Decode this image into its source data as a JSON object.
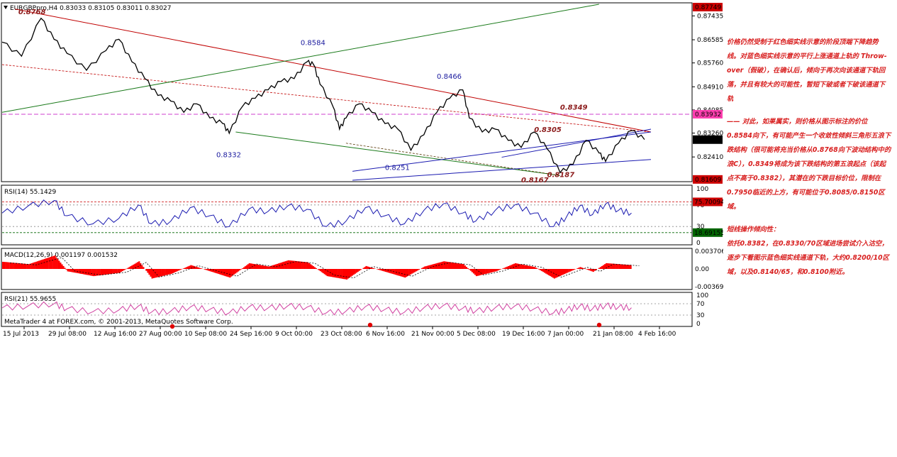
{
  "chart_data": [
    {
      "type": "line",
      "panel": "price",
      "series_name": "EURGBPpro,H4",
      "ohlc_text": "0.83033 0.83105 0.83011 0.83027",
      "yticks": [
        "0.87435",
        "0.86585",
        "0.85760",
        "0.84910",
        "0.84085",
        "0.83260",
        "0.82410"
      ],
      "ylim": [
        0.8158,
        0.8785
      ],
      "price_tags": [
        {
          "text": "0.87749",
          "value": 0.87749,
          "bg": "#cc0000",
          "fg": "#ffffff"
        },
        {
          "text": "0.83932",
          "value": 0.83932,
          "bg": "#ff3fb0",
          "fg": "#ffffff"
        },
        {
          "text": "0.83027",
          "value": 0.83027,
          "bg": "#000000",
          "fg": "#ffffff"
        },
        {
          "text": "0.81609",
          "value": 0.81609,
          "bg": "#cc0000",
          "fg": "#ffffff"
        }
      ],
      "annotations": [
        {
          "text": "0.8768",
          "style": "red",
          "x": 2.5,
          "y": 0.875
        },
        {
          "text": "0.8584",
          "style": "blue",
          "x": 46,
          "y": 0.864
        },
        {
          "text": "0.8466",
          "style": "blue",
          "x": 67,
          "y": 0.852
        },
        {
          "text": "0.8349",
          "style": "red",
          "x": 86,
          "y": 0.841
        },
        {
          "text": "0.8305",
          "style": "red",
          "x": 82,
          "y": 0.833
        },
        {
          "text": "0.8332",
          "style": "blue",
          "x": 33,
          "y": 0.824
        },
        {
          "text": "0.8251",
          "style": "blue",
          "x": 59,
          "y": 0.8195
        },
        {
          "text": "0.8167",
          "style": "red",
          "x": 80,
          "y": 0.815
        },
        {
          "text": "0.8187",
          "style": "red",
          "x": 84,
          "y": 0.817
        }
      ],
      "points": [
        [
          0,
          0.865
        ],
        [
          3,
          0.86
        ],
        [
          6,
          0.8735
        ],
        [
          8,
          0.866
        ],
        [
          10,
          0.861
        ],
        [
          13,
          0.855
        ],
        [
          16,
          0.862
        ],
        [
          18,
          0.866
        ],
        [
          20,
          0.858
        ],
        [
          22,
          0.852
        ],
        [
          24,
          0.846
        ],
        [
          26,
          0.844
        ],
        [
          28,
          0.84
        ],
        [
          30,
          0.843
        ],
        [
          32,
          0.838
        ],
        [
          34,
          0.836
        ],
        [
          35,
          0.8325
        ],
        [
          37,
          0.842
        ],
        [
          39,
          0.845
        ],
        [
          41,
          0.848
        ],
        [
          43,
          0.851
        ],
        [
          45,
          0.852
        ],
        [
          47,
          0.858
        ],
        [
          48,
          0.857
        ],
        [
          49,
          0.85
        ],
        [
          51,
          0.842
        ],
        [
          52,
          0.834
        ],
        [
          53,
          0.838
        ],
        [
          55,
          0.843
        ],
        [
          57,
          0.84
        ],
        [
          59,
          0.836
        ],
        [
          61,
          0.834
        ],
        [
          63,
          0.8265
        ],
        [
          65,
          0.832
        ],
        [
          67,
          0.84
        ],
        [
          69,
          0.845
        ],
        [
          71,
          0.848
        ],
        [
          72,
          0.838
        ],
        [
          74,
          0.833
        ],
        [
          76,
          0.834
        ],
        [
          78,
          0.83
        ],
        [
          80,
          0.8275
        ],
        [
          82,
          0.833
        ],
        [
          84,
          0.827
        ],
        [
          86,
          0.8185
        ],
        [
          88,
          0.8215
        ],
        [
          90,
          0.83
        ],
        [
          92,
          0.8255
        ],
        [
          93,
          0.8225
        ],
        [
          95,
          0.829
        ],
        [
          97,
          0.8335
        ],
        [
          99,
          0.8303
        ]
      ],
      "x_range": [
        0,
        100
      ]
    },
    {
      "type": "line",
      "panel": "rsi14",
      "title_text": "RSI(14) 55.1429",
      "yticks": [
        "100",
        "70",
        "30",
        "0"
      ],
      "ylim": [
        0,
        100
      ],
      "levels": [
        {
          "value": 75.70094,
          "text": "75.70094",
          "bg": "#cc0000"
        },
        {
          "value": 18.69155,
          "text": "18.69155",
          "bg": "#006400"
        }
      ],
      "points": [
        [
          0,
          55
        ],
        [
          4,
          68
        ],
        [
          8,
          78
        ],
        [
          10,
          50
        ],
        [
          14,
          35
        ],
        [
          18,
          45
        ],
        [
          21,
          70
        ],
        [
          23,
          35
        ],
        [
          26,
          40
        ],
        [
          29,
          65
        ],
        [
          32,
          50
        ],
        [
          35,
          30
        ],
        [
          38,
          62
        ],
        [
          41,
          58
        ],
        [
          44,
          68
        ],
        [
          47,
          62
        ],
        [
          50,
          30
        ],
        [
          53,
          40
        ],
        [
          56,
          65
        ],
        [
          59,
          50
        ],
        [
          62,
          35
        ],
        [
          65,
          60
        ],
        [
          68,
          72
        ],
        [
          71,
          55
        ],
        [
          73,
          40
        ],
        [
          76,
          60
        ],
        [
          79,
          70
        ],
        [
          82,
          55
        ],
        [
          85,
          30
        ],
        [
          87,
          48
        ],
        [
          89,
          68
        ],
        [
          91,
          52
        ],
        [
          93,
          72
        ],
        [
          95,
          60
        ],
        [
          97,
          55
        ]
      ]
    },
    {
      "type": "bar",
      "panel": "macd",
      "title_text": "MACD(12,26,9) 0.001197 0.001532",
      "yticks": [
        "0.003706",
        "0.00",
        "-0.003694"
      ],
      "ylim": [
        -0.0037,
        0.0037
      ],
      "points": [
        [
          0,
          0.0015
        ],
        [
          4,
          0.001
        ],
        [
          8,
          0.0028
        ],
        [
          10,
          -0.0005
        ],
        [
          14,
          -0.0015
        ],
        [
          18,
          -0.0008
        ],
        [
          21,
          0.0016
        ],
        [
          23,
          -0.002
        ],
        [
          26,
          -0.001
        ],
        [
          29,
          0.0008
        ],
        [
          32,
          -0.0005
        ],
        [
          35,
          -0.0018
        ],
        [
          38,
          0.0012
        ],
        [
          41,
          0.0005
        ],
        [
          44,
          0.0018
        ],
        [
          47,
          0.0014
        ],
        [
          50,
          -0.0015
        ],
        [
          53,
          -0.0022
        ],
        [
          56,
          0.0006
        ],
        [
          59,
          -0.0006
        ],
        [
          62,
          -0.0018
        ],
        [
          65,
          0.0005
        ],
        [
          68,
          0.0016
        ],
        [
          71,
          0.001
        ],
        [
          73,
          -0.0015
        ],
        [
          76,
          -0.0005
        ],
        [
          79,
          0.0012
        ],
        [
          82,
          0.0004
        ],
        [
          85,
          -0.002
        ],
        [
          87,
          -0.0008
        ],
        [
          89,
          0.0004
        ],
        [
          91,
          -0.0006
        ],
        [
          93,
          0.0012
        ],
        [
          95,
          0.001
        ],
        [
          97,
          0.0008
        ]
      ]
    },
    {
      "type": "line",
      "panel": "rsi21",
      "title_text": "RSI(21) 55.9655",
      "yticks": [
        "100",
        "70",
        "30",
        "0"
      ],
      "ylim": [
        0,
        100
      ],
      "points": [
        [
          0,
          55
        ],
        [
          4,
          62
        ],
        [
          8,
          70
        ],
        [
          10,
          52
        ],
        [
          14,
          42
        ],
        [
          18,
          48
        ],
        [
          21,
          62
        ],
        [
          23,
          40
        ],
        [
          26,
          44
        ],
        [
          29,
          58
        ],
        [
          32,
          50
        ],
        [
          35,
          38
        ],
        [
          38,
          58
        ],
        [
          41,
          55
        ],
        [
          44,
          62
        ],
        [
          47,
          58
        ],
        [
          50,
          38
        ],
        [
          53,
          44
        ],
        [
          56,
          60
        ],
        [
          59,
          50
        ],
        [
          62,
          40
        ],
        [
          65,
          56
        ],
        [
          68,
          64
        ],
        [
          71,
          54
        ],
        [
          73,
          44
        ],
        [
          76,
          56
        ],
        [
          79,
          62
        ],
        [
          82,
          52
        ],
        [
          85,
          38
        ],
        [
          87,
          48
        ],
        [
          89,
          62
        ],
        [
          91,
          52
        ],
        [
          93,
          64
        ],
        [
          95,
          58
        ],
        [
          97,
          56
        ]
      ]
    }
  ],
  "x_axis_labels": [
    "15 Jul 2013",
    "29 Jul 08:00",
    "12 Aug 16:00",
    "27 Aug 00:00",
    "10 Sep 08:00",
    "24 Sep 16:00",
    "9 Oct 00:00",
    "23 Oct 08:00",
    "6 Nov 16:00",
    "21 Nov 00:00",
    "5 Dec 08:00",
    "19 Dec 16:00",
    "7 Jan 00:00",
    "21 Jan 08:00",
    "4 Feb 16:00"
  ],
  "copyright": "MetaTrader 4 at FOREX.com, © 2001-2013, MetaQuotes Software Corp.",
  "colors": {
    "red_channel": "#c00000",
    "green_channel": "#1a7a1a",
    "blue_channel": "#1a1ab0",
    "magenta_line": "#c000c0",
    "rsi_line": "#1a1ab0",
    "rsi21_line": "#d040a0",
    "macd_hist": "#ff0000"
  },
  "commentary": {
    "para1": "价格仍然受制于红色细实线示意的阶段顶端下降趋势线。对蓝色细实线示意的平行上涨通道上轨的 Throw-over（假破），在确认后，倾向于再次向该通道下轨回落，并且有较大的可能性，暂短下破或者下破该通道下轨",
    "para2": "—— 对此，如果属实，则价格从图示标注的价位0.8584向下，有可能产生一个收敛性倾斜三角形五浪下跌结构（很可能将充当价格从0.8768向下波动结构中的浪C），0.8349将成为该下跌结构的第五浪起点（该起点不高于0.8382），其潜在的下跌目标价位，限制在0.7950临近的上方，有可能位于0.8085/0.8150区域。",
    "para3_title": "短线操作倾向性：",
    "para3": "依托0.8382，在0.8330/70区域进场尝试介入沽空，逐步下看图示蓝色细实线通道下轨，大约0.8200/10区域，以及0.8140/65，和0.8100附近。"
  }
}
